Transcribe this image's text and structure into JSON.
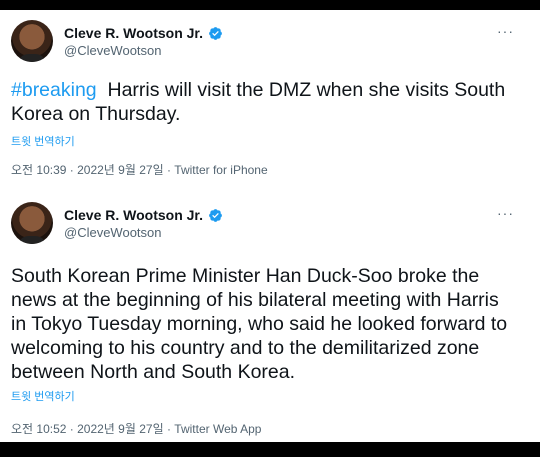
{
  "tweets": [
    {
      "author_name": "Cleve R. Wootson Jr.",
      "handle": "@CleveWootson",
      "hashtag": "#breaking",
      "text": "Harris will visit the DMZ when she visits South Korea on Thursday.",
      "translate_label": "트윗 번역하기",
      "timestamp": "오전 10:39 · 2022년 9월 27일 · ",
      "source": "Twitter for iPhone",
      "more_label": "···"
    },
    {
      "author_name": "Cleve R. Wootson Jr.",
      "handle": "@CleveWootson",
      "text": "South Korean Prime Minister Han Duck-Soo broke the news at the beginning of his bilateral meeting with Harris in Tokyo Tuesday morning, who said he looked forward to welcoming to his country and to the demilitarized zone between North and South Korea.",
      "translate_label": "트윗 번역하기",
      "timestamp": "오전 10:52 · 2022년 9월 27일 · ",
      "source": "Twitter Web App",
      "more_label": "···"
    }
  ],
  "colors": {
    "accent": "#1d9bf0",
    "text": "#0f1419",
    "secondary": "#536471"
  },
  "icons": {
    "verified": "verified-badge-icon",
    "more": "more-options-icon"
  }
}
